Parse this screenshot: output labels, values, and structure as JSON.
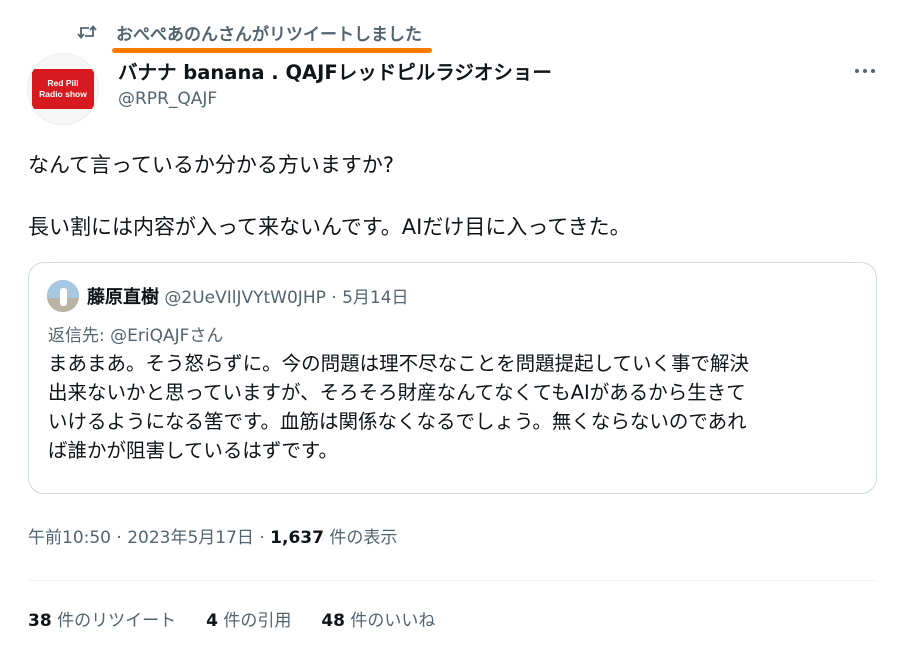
{
  "retweet_banner": {
    "icon": "retweet-icon",
    "text": "おぺぺあのんさんがリツイートしました",
    "highlight_color": "#ff7a00"
  },
  "author": {
    "avatar_line1": "Red Pill",
    "avatar_line2": "Radio show",
    "display_name": "バナナ banana . QAJFレッドピルラジオショー",
    "handle": "@RPR_QAJF"
  },
  "tweet": {
    "line1": "なんて言っているか分かる方いますか?",
    "line2": "長い割には内容が入って来ないんです。AIだけ目に入ってきた。"
  },
  "quote": {
    "name": "藤原直樹",
    "handle": "@2UeVIlJVYtW0JHP",
    "separator": "·",
    "date": "5月14日",
    "reply_prefix": "返信先: ",
    "reply_to": "@EriQAJFさん",
    "body_lines": [
      "まあまあ。そう怒らずに。今の問題は理不尽なことを問題提起していく事で解決",
      "出来ないかと思っていますが、そろそろ財産なんてなくてもAIがあるから生きて",
      "いけるようになる筈です。血筋は関係なくなるでしょう。無くならないのであれ",
      "ば誰かが阻害しているはずです。"
    ]
  },
  "meta": {
    "time": "午前10:50",
    "separator": "·",
    "date": "2023年5月17日",
    "views": "1,637",
    "views_label": "件の表示"
  },
  "stats": {
    "retweets": "38",
    "retweets_label": "件のリツイート",
    "quotes": "4",
    "quotes_label": "件の引用",
    "likes": "48",
    "likes_label": "件のいいね"
  },
  "colors": {
    "text_primary": "#0f1419",
    "text_secondary": "#536471",
    "border": "#cfd9de",
    "avatar_red": "#d71920"
  }
}
